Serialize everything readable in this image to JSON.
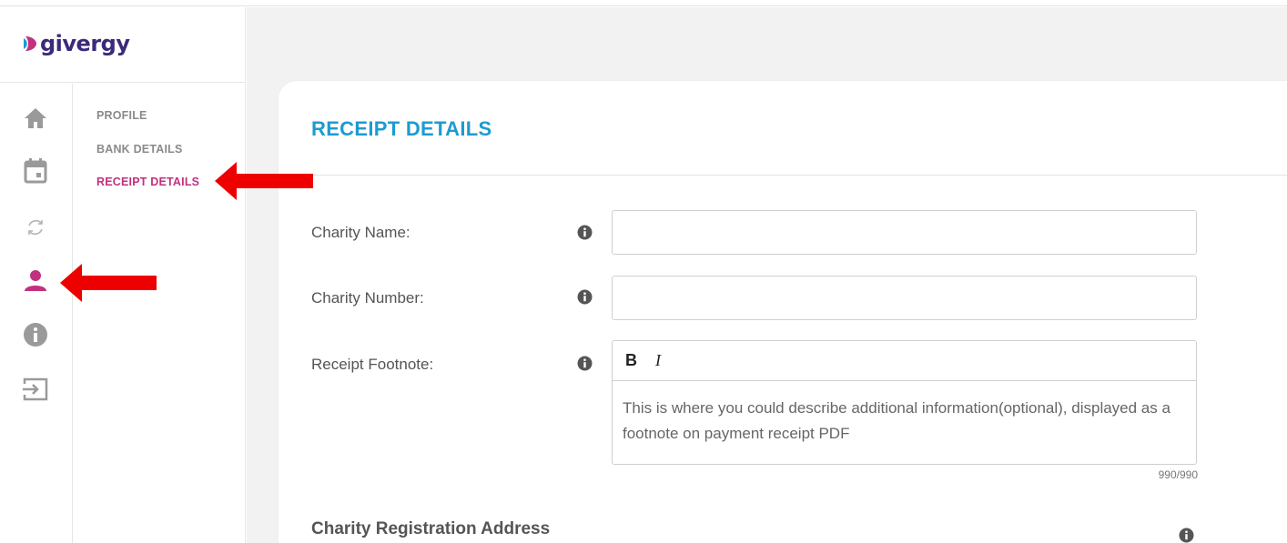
{
  "brand": {
    "name": "givergy",
    "name_color": "#3b2a7a",
    "mark_colors": [
      "#1d9bd1",
      "#c2307f"
    ]
  },
  "rail": {
    "icons": [
      {
        "name": "home-icon",
        "active": false
      },
      {
        "name": "calendar-icon",
        "active": false
      },
      {
        "name": "refresh-icon",
        "active": false
      },
      {
        "name": "user-icon",
        "active": true
      },
      {
        "name": "info-icon",
        "active": false
      },
      {
        "name": "logout-icon",
        "active": false
      }
    ]
  },
  "subnav": {
    "items": [
      {
        "label": "PROFILE",
        "active": false
      },
      {
        "label": "BANK DETAILS",
        "active": false
      },
      {
        "label": "RECEIPT DETAILS",
        "active": true
      }
    ]
  },
  "card": {
    "title": "RECEIPT DETAILS",
    "fields": {
      "charity_name": {
        "label": "Charity Name:",
        "value": ""
      },
      "charity_number": {
        "label": "Charity Number:",
        "value": ""
      },
      "receipt_footnote": {
        "label": "Receipt Footnote:",
        "toolbar": {
          "bold": "B",
          "italic": "I"
        },
        "placeholder": "This is where you could describe additional information(optional), displayed as a footnote on payment receipt PDF",
        "counter": "990/990"
      }
    },
    "section_title": "Charity Registration Address"
  },
  "colors": {
    "accent_blue": "#1d9bd1",
    "accent_pink": "#c2307f",
    "arrow_red": "#ee0000"
  }
}
